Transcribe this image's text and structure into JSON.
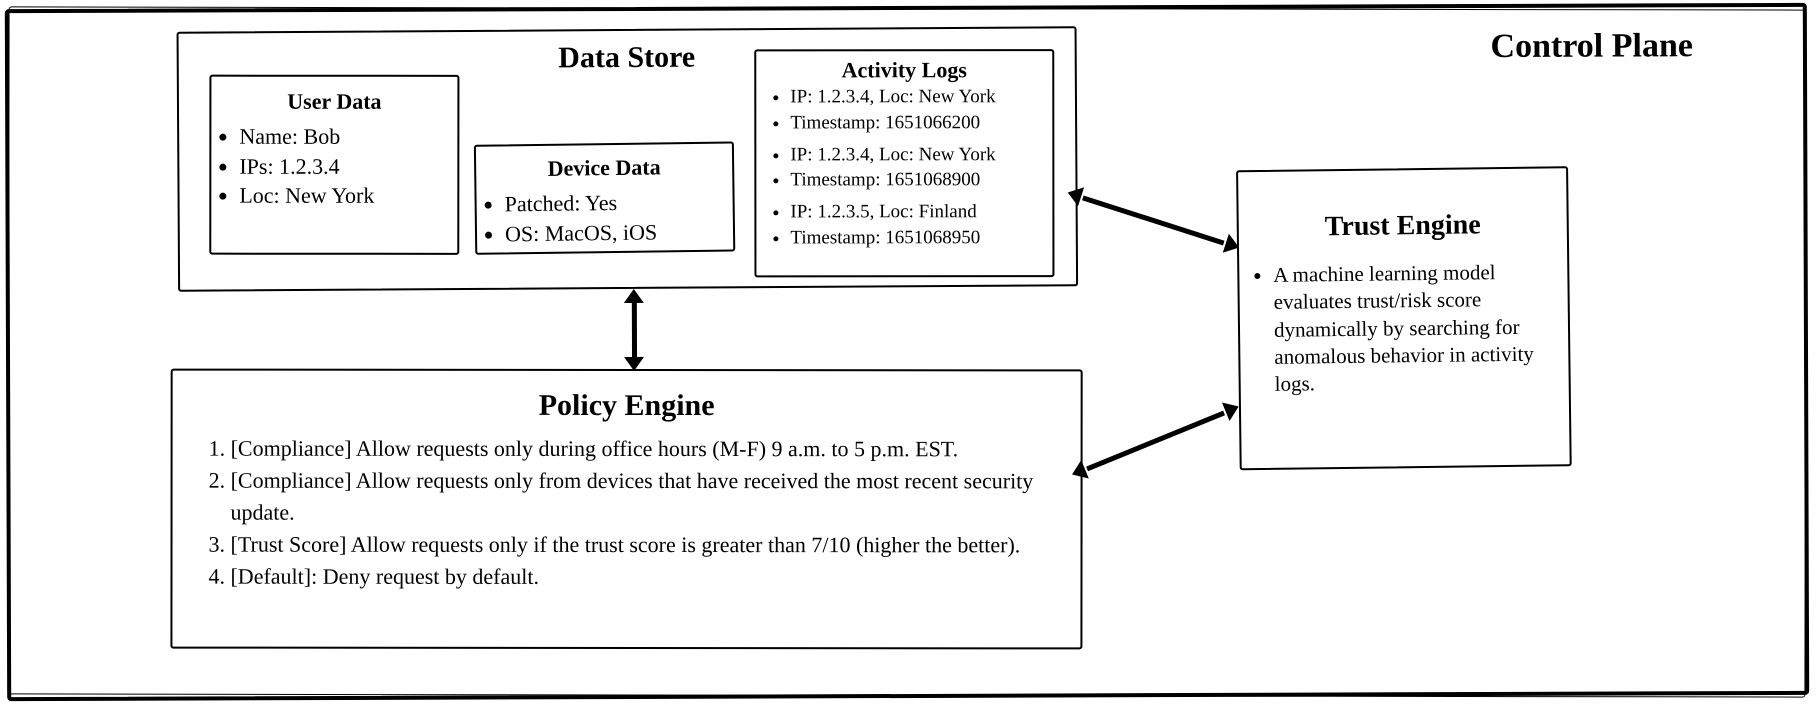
{
  "plane_title": "Control Plane",
  "datastore": {
    "title": "Data Store",
    "user": {
      "title": "User Data",
      "name": "Name: Bob",
      "ips": "IPs: 1.2.3.4",
      "loc": "Loc: New York"
    },
    "device": {
      "title": "Device Data",
      "patched": "Patched: Yes",
      "os": "OS: MacOS, iOS"
    },
    "activity": {
      "title": "Activity Logs",
      "entries": [
        {
          "ip": "IP: 1.2.3.4, Loc: New York",
          "ts": "Timestamp: 1651066200"
        },
        {
          "ip": "IP: 1.2.3.4, Loc: New York",
          "ts": "Timestamp: 1651068900"
        },
        {
          "ip": "IP: 1.2.3.5, Loc: Finland",
          "ts": "Timestamp: 1651068950"
        }
      ]
    }
  },
  "policy": {
    "title": "Policy Engine",
    "rules": [
      "[Compliance] Allow requests only during office hours (M-F) 9 a.m. to 5 p.m. EST.",
      "[Compliance] Allow requests only from devices that have received the most recent security update.",
      "[Trust Score] Allow requests only if the trust score is greater than 7/10 (higher the better).",
      "[Default]: Deny request by default."
    ]
  },
  "trust": {
    "title": "Trust Engine",
    "desc": "A machine learning model evaluates trust/risk score dynamically by searching for anomalous behavior in activity logs."
  }
}
